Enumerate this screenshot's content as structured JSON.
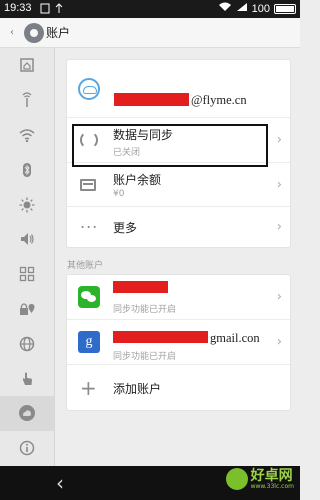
{
  "status_bar": {
    "time": "19:33",
    "battery": "100"
  },
  "header": {
    "title": "账户"
  },
  "sidebar": {
    "items": [
      {
        "icon": "home-icon"
      },
      {
        "icon": "signal-icon"
      },
      {
        "icon": "wifi-icon"
      },
      {
        "icon": "bluetooth-icon"
      },
      {
        "icon": "brightness-icon"
      },
      {
        "icon": "volume-icon"
      },
      {
        "icon": "grid-icon"
      },
      {
        "icon": "lock-location-icon"
      },
      {
        "icon": "globe-icon"
      },
      {
        "icon": "hand-icon"
      },
      {
        "icon": "cloud-icon"
      },
      {
        "icon": "info-icon"
      }
    ],
    "active_index": 10
  },
  "account": {
    "email_suffix": "@flyme.cn"
  },
  "menu": {
    "sync": {
      "label": "数据与同步",
      "status": "已关闭"
    },
    "balance": {
      "label": "账户余额",
      "value": "¥0"
    },
    "more": {
      "label": "更多"
    }
  },
  "other_accounts": {
    "section_label": "其他账户",
    "items": [
      {
        "icon": "wechat-icon",
        "status": "同步功能已开启"
      },
      {
        "icon": "google-icon",
        "email_suffix": "gmail.con",
        "status": "同步功能已开启"
      }
    ],
    "add_label": "添加账户"
  },
  "watermark": {
    "name": "好卓网",
    "url": "www.33lc.com"
  },
  "colors": {
    "redaction": "#e21e1e",
    "wechat": "#2bb32b",
    "google": "#2f6bc8",
    "cloud": "#5aa6e0"
  }
}
